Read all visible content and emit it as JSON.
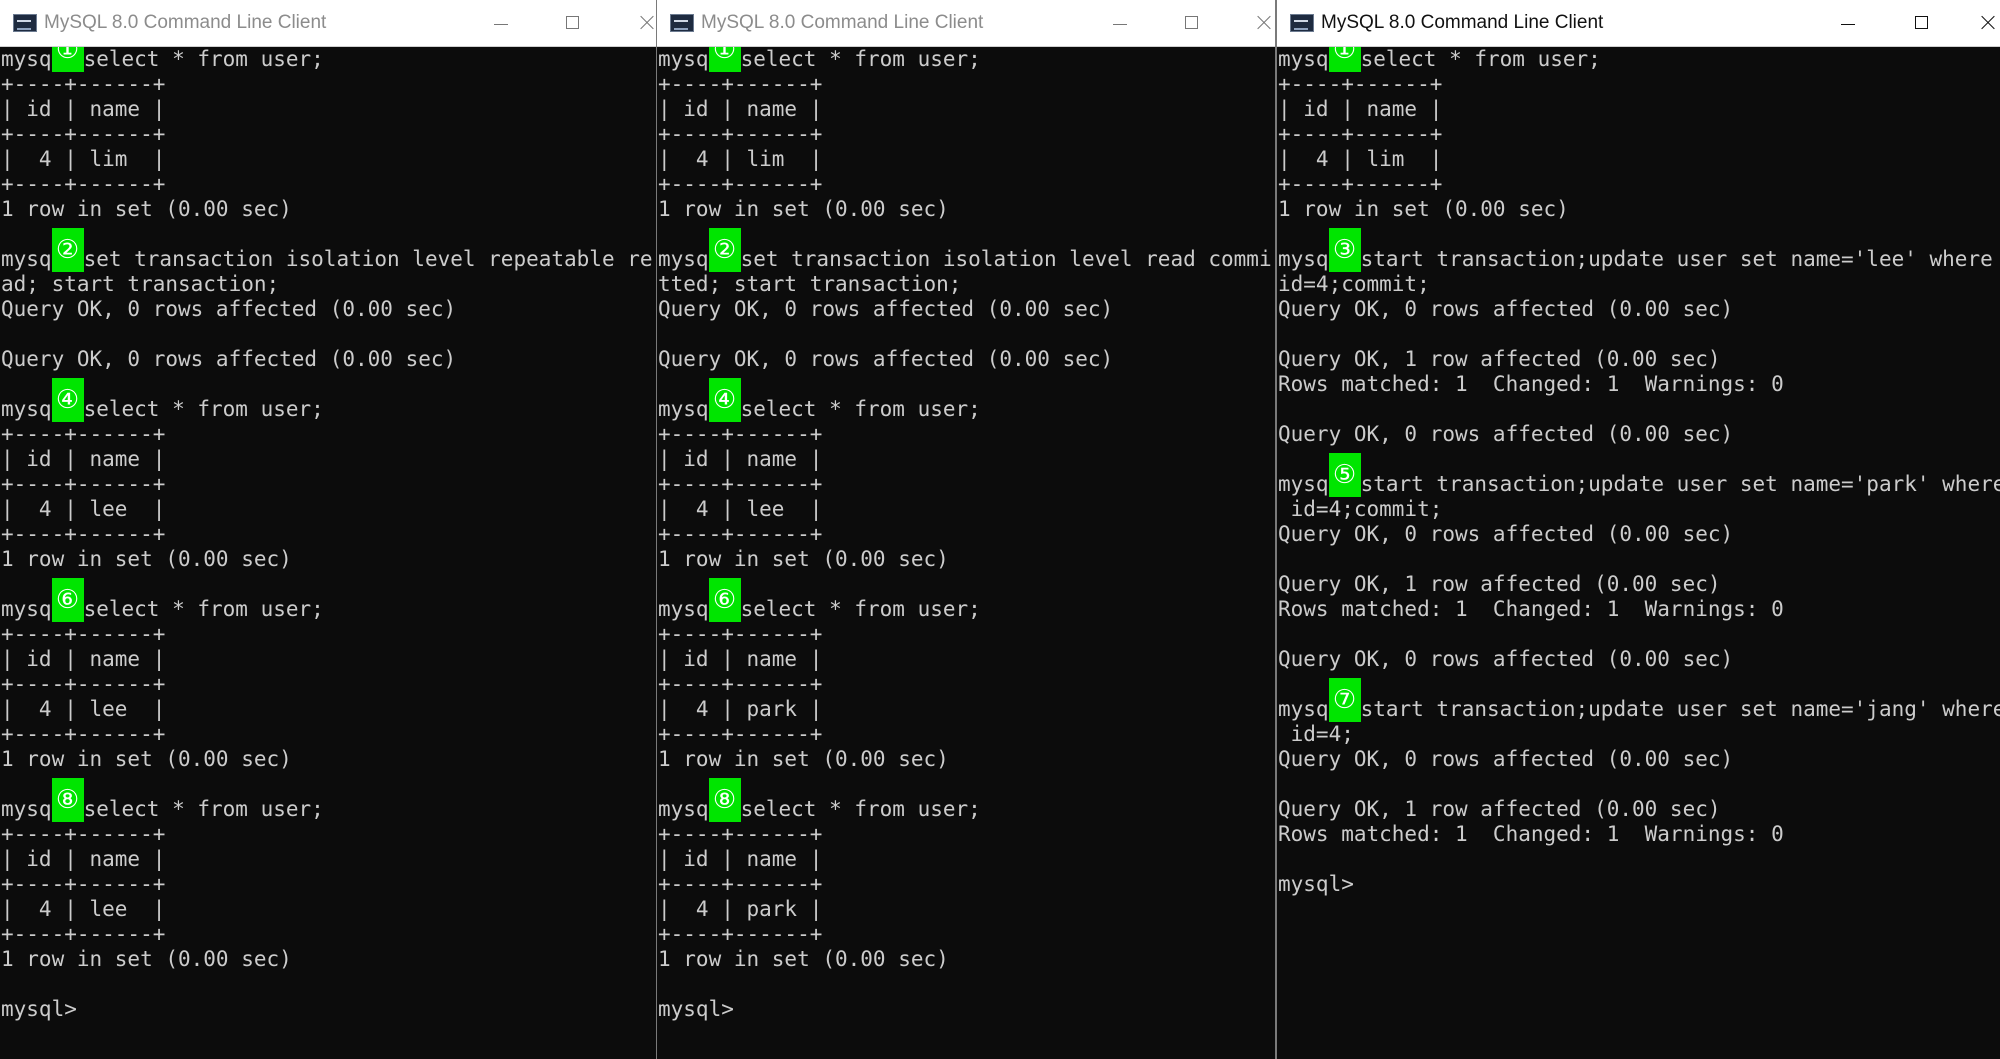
{
  "windows": [
    {
      "title": "MySQL 8.0 Command Line Client",
      "active": false,
      "lines": [
        {
          "pre": "mysq",
          "badge": "①",
          "post": "select * from user;"
        },
        {
          "text": "+----+------+"
        },
        {
          "text": "| id | name |"
        },
        {
          "text": "+----+------+"
        },
        {
          "text": "|  4 | lim  |"
        },
        {
          "text": "+----+------+"
        },
        {
          "text": "1 row in set (0.00 sec)"
        },
        {
          "text": ""
        },
        {
          "pre": "mysq",
          "badge": "②",
          "post": "set transaction isolation level repeatable re"
        },
        {
          "text": "ad; start transaction;"
        },
        {
          "text": "Query OK, 0 rows affected (0.00 sec)"
        },
        {
          "text": ""
        },
        {
          "text": "Query OK, 0 rows affected (0.00 sec)"
        },
        {
          "text": ""
        },
        {
          "pre": "mysq",
          "badge": "④",
          "post": "select * from user;"
        },
        {
          "text": "+----+------+"
        },
        {
          "text": "| id | name |"
        },
        {
          "text": "+----+------+"
        },
        {
          "text": "|  4 | lee  |"
        },
        {
          "text": "+----+------+"
        },
        {
          "text": "1 row in set (0.00 sec)"
        },
        {
          "text": ""
        },
        {
          "pre": "mysq",
          "badge": "⑥",
          "post": "select * from user;"
        },
        {
          "text": "+----+------+"
        },
        {
          "text": "| id | name |"
        },
        {
          "text": "+----+------+"
        },
        {
          "text": "|  4 | lee  |"
        },
        {
          "text": "+----+------+"
        },
        {
          "text": "1 row in set (0.00 sec)"
        },
        {
          "text": ""
        },
        {
          "pre": "mysq",
          "badge": "⑧",
          "post": "select * from user;"
        },
        {
          "text": "+----+------+"
        },
        {
          "text": "| id | name |"
        },
        {
          "text": "+----+------+"
        },
        {
          "text": "|  4 | lee  |"
        },
        {
          "text": "+----+------+"
        },
        {
          "text": "1 row in set (0.00 sec)"
        },
        {
          "text": ""
        },
        {
          "text": "mysql>"
        }
      ]
    },
    {
      "title": "MySQL 8.0 Command Line Client",
      "active": false,
      "lines": [
        {
          "pre": "mysq",
          "badge": "①",
          "post": "select * from user;"
        },
        {
          "text": "+----+------+"
        },
        {
          "text": "| id | name |"
        },
        {
          "text": "+----+------+"
        },
        {
          "text": "|  4 | lim  |"
        },
        {
          "text": "+----+------+"
        },
        {
          "text": "1 row in set (0.00 sec)"
        },
        {
          "text": ""
        },
        {
          "pre": "mysq",
          "badge": "②",
          "post": "set transaction isolation level read commi"
        },
        {
          "text": "tted; start transaction;"
        },
        {
          "text": "Query OK, 0 rows affected (0.00 sec)"
        },
        {
          "text": ""
        },
        {
          "text": "Query OK, 0 rows affected (0.00 sec)"
        },
        {
          "text": ""
        },
        {
          "pre": "mysq",
          "badge": "④",
          "post": "select * from user;"
        },
        {
          "text": "+----+------+"
        },
        {
          "text": "| id | name |"
        },
        {
          "text": "+----+------+"
        },
        {
          "text": "|  4 | lee  |"
        },
        {
          "text": "+----+------+"
        },
        {
          "text": "1 row in set (0.00 sec)"
        },
        {
          "text": ""
        },
        {
          "pre": "mysq",
          "badge": "⑥",
          "post": "select * from user;"
        },
        {
          "text": "+----+------+"
        },
        {
          "text": "| id | name |"
        },
        {
          "text": "+----+------+"
        },
        {
          "text": "|  4 | park |"
        },
        {
          "text": "+----+------+"
        },
        {
          "text": "1 row in set (0.00 sec)"
        },
        {
          "text": ""
        },
        {
          "pre": "mysq",
          "badge": "⑧",
          "post": "select * from user;"
        },
        {
          "text": "+----+------+"
        },
        {
          "text": "| id | name |"
        },
        {
          "text": "+----+------+"
        },
        {
          "text": "|  4 | park |"
        },
        {
          "text": "+----+------+"
        },
        {
          "text": "1 row in set (0.00 sec)"
        },
        {
          "text": ""
        },
        {
          "text": "mysql>"
        }
      ]
    },
    {
      "title": "MySQL 8.0 Command Line Client",
      "active": true,
      "lines": [
        {
          "pre": "mysq",
          "badge": "①",
          "post": "select * from user;"
        },
        {
          "text": "+----+------+"
        },
        {
          "text": "| id | name |"
        },
        {
          "text": "+----+------+"
        },
        {
          "text": "|  4 | lim  |"
        },
        {
          "text": "+----+------+"
        },
        {
          "text": "1 row in set (0.00 sec)"
        },
        {
          "text": ""
        },
        {
          "pre": "mysq",
          "badge": "③",
          "post": "start transaction;update user set name='lee' where"
        },
        {
          "text": "id=4;commit;"
        },
        {
          "text": "Query OK, 0 rows affected (0.00 sec)"
        },
        {
          "text": ""
        },
        {
          "text": "Query OK, 1 row affected (0.00 sec)"
        },
        {
          "text": "Rows matched: 1  Changed: 1  Warnings: 0"
        },
        {
          "text": ""
        },
        {
          "text": "Query OK, 0 rows affected (0.00 sec)"
        },
        {
          "text": ""
        },
        {
          "pre": "mysq",
          "badge": "⑤",
          "post": "start transaction;update user set name='park' where"
        },
        {
          "text": " id=4;commit;"
        },
        {
          "text": "Query OK, 0 rows affected (0.00 sec)"
        },
        {
          "text": ""
        },
        {
          "text": "Query OK, 1 row affected (0.00 sec)"
        },
        {
          "text": "Rows matched: 1  Changed: 1  Warnings: 0"
        },
        {
          "text": ""
        },
        {
          "text": "Query OK, 0 rows affected (0.00 sec)"
        },
        {
          "text": ""
        },
        {
          "pre": "mysq",
          "badge": "⑦",
          "post": "start transaction;update user set name='jang' where"
        },
        {
          "text": " id=4;"
        },
        {
          "text": "Query OK, 0 rows affected (0.00 sec)"
        },
        {
          "text": ""
        },
        {
          "text": "Query OK, 1 row affected (0.00 sec)"
        },
        {
          "text": "Rows matched: 1  Changed: 1  Warnings: 0"
        },
        {
          "text": ""
        },
        {
          "text": "mysql>"
        }
      ]
    }
  ],
  "colors": {
    "console_bg": "#0c0c0c",
    "console_text": "#cccccc",
    "badge_bg": "#00e500",
    "titlebar_bg": "#ffffff"
  },
  "icons": {
    "app": "mysql-console-icon",
    "minimize": "minimize-icon",
    "maximize": "maximize-icon",
    "close": "close-icon"
  }
}
